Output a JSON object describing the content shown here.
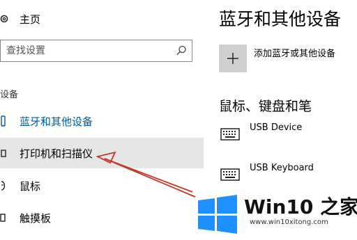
{
  "sidebar": {
    "home_label": "主页",
    "search_placeholder": "查找设置",
    "section_label": "设备",
    "items": [
      {
        "label": "蓝牙和其他设备",
        "state": "selected"
      },
      {
        "label": "打印机和扫描仪",
        "state": "hovered"
      },
      {
        "label": "鼠标",
        "state": "normal"
      },
      {
        "label": "触摸板",
        "state": "normal"
      }
    ]
  },
  "main": {
    "title": "蓝牙和其他设备",
    "add_device_label": "添加蓝牙或其他设备",
    "mouse_keyboard_heading": "鼠标、键盘和笔",
    "devices": [
      {
        "name": "USB Device",
        "icon": "keyboard-icon"
      },
      {
        "name": "USB Keyboard",
        "icon": "keyboard-icon"
      }
    ]
  },
  "watermark": {
    "brand": "Win10 之家",
    "url": "www.win10xitong.com"
  },
  "colors": {
    "accent": "#005a9e",
    "hover_bg": "#e6e6e6",
    "annotation_arrow": "#c0392b",
    "logo_blue": "#1e90ff"
  }
}
